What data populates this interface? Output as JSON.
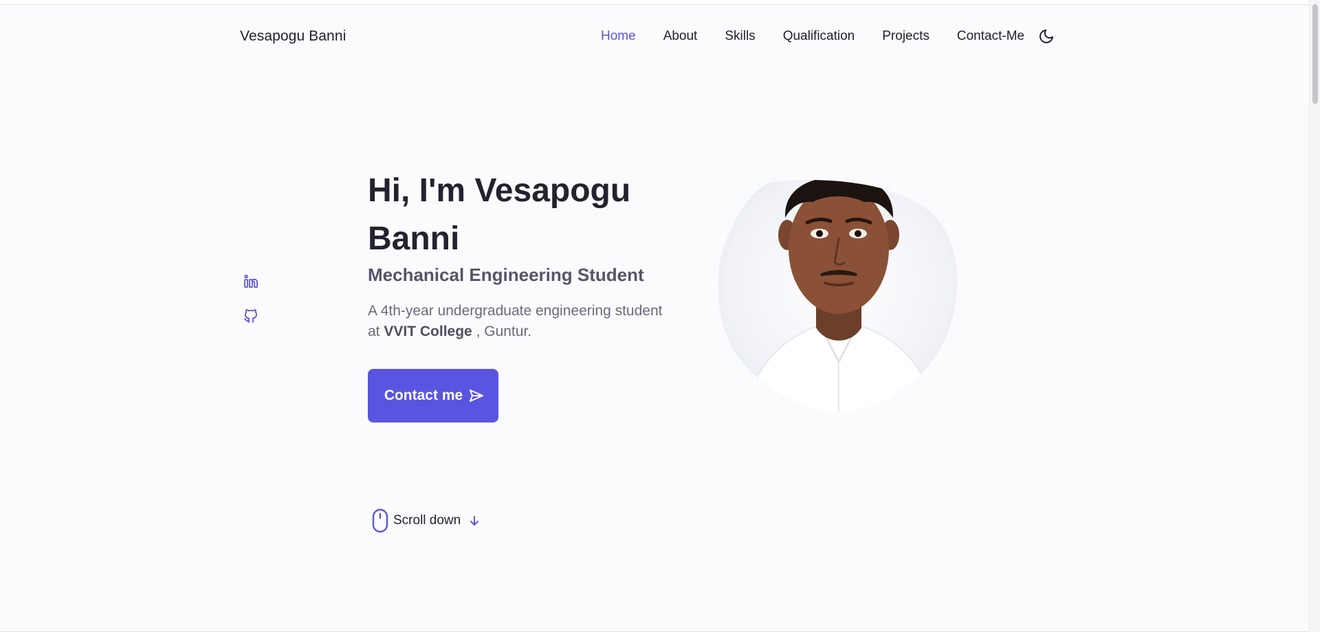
{
  "header": {
    "logo": "Vesapogu Banni",
    "nav": [
      {
        "label": "Home",
        "active": true
      },
      {
        "label": "About",
        "active": false
      },
      {
        "label": "Skills",
        "active": false
      },
      {
        "label": "Qualification",
        "active": false
      },
      {
        "label": "Projects",
        "active": false
      },
      {
        "label": "Contact-Me",
        "active": false
      }
    ],
    "theme_icon": "moon-icon"
  },
  "social": [
    {
      "icon": "linkedin-icon"
    },
    {
      "icon": "github-icon"
    }
  ],
  "hero": {
    "title_line1": "Hi, I'm Vesapogu",
    "title_line2": "Banni",
    "subtitle": "Mechanical Engineering Student",
    "desc_before": "A 4th-year undergraduate engineering student at",
    "desc_bold": "VVIT College",
    "desc_after": ", Guntur.",
    "cta_label": "Contact me",
    "cta_icon": "send-icon"
  },
  "scroll": {
    "label": "Scroll down",
    "icon": "mouse-icon",
    "arrow_icon": "arrow-down-icon"
  },
  "colors": {
    "accent": "#5a55e0",
    "text": "#1f1f2e",
    "muted": "#6a6a7c",
    "background": "#fbfbfd"
  }
}
